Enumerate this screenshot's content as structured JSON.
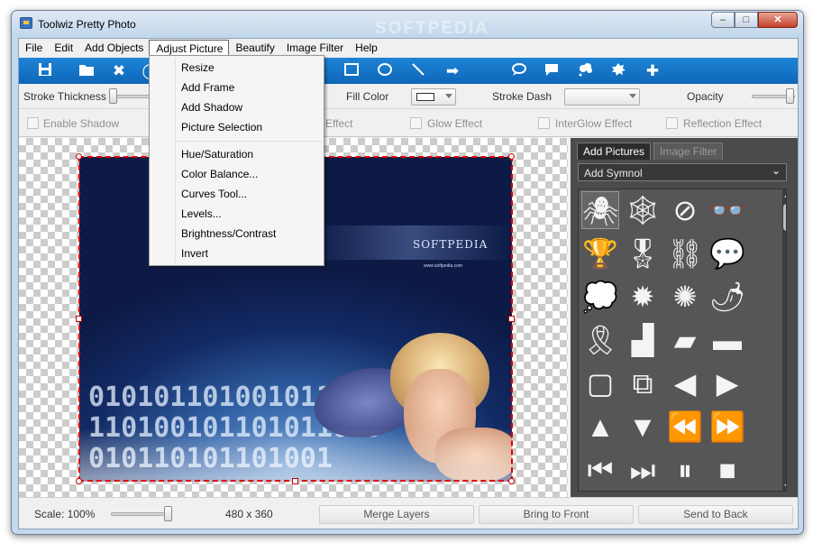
{
  "window": {
    "title": "Toolwiz Pretty Photo",
    "minimize": "–",
    "maximize": "□",
    "close": "✕"
  },
  "watermarks": [
    "SOFTPEDIA",
    "SOFTPEDIA"
  ],
  "menu": {
    "items": [
      "File",
      "Edit",
      "Add Objects",
      "Adjust Picture",
      "Beautify",
      "Image Filter",
      "Help"
    ],
    "active": "Adjust Picture"
  },
  "dropdown": {
    "items": [
      "Resize",
      "Add Frame",
      "Add Shadow",
      "Picture Selection",
      "Hue/Saturation",
      "Color Balance...",
      "Curves Tool...",
      "Levels...",
      "Brightness/Contrast",
      "Invert"
    ]
  },
  "toolbar": {
    "icons": [
      "save-icon",
      "open-folder-icon",
      "delete-icon",
      "ellipse-tool-icon",
      "rectangle-icon",
      "circle-icon",
      "line-icon",
      "arrow-icon",
      "speech-bubble-icon",
      "callout-icon",
      "cloud-bubble-icon",
      "burst-bubble-icon",
      "puzzle-icon"
    ]
  },
  "props": {
    "stroke_thickness": "Stroke Thickness",
    "fill_color": "Fill Color",
    "stroke_dash": "Stroke Dash",
    "opacity": "Opacity",
    "enable_shadow": "Enable Shadow",
    "effect": "Effect",
    "glow_effect": "Glow Effect",
    "interglow_effect": "InterGlow Effect",
    "reflection_effect": "Reflection Effect"
  },
  "photo": {
    "logo": "SOFTPEDIA",
    "url": "www.softpedia.com",
    "digits": "010101101001011010110100101101011010010110101101001"
  },
  "panel": {
    "tabs": [
      "Add Pictures",
      "Image Filter"
    ],
    "symbol_select": "Add Symnol",
    "symbols": [
      "spider-icon",
      "web-icon",
      "no-drink-icon",
      "sunglasses-icon",
      "trophy-icon",
      "medal-icon",
      "chain-icon",
      "speech-bubble-icon",
      "ellipse-bubble-icon",
      "burst-icon",
      "explosion-icon",
      "chili-icon",
      "ribbon-icon",
      "stairs-icon",
      "parallelogram-icon",
      "bar-icon",
      "frame-icon",
      "double-frame-icon",
      "triangle-left-icon",
      "triangle-right-icon",
      "triangle-up-icon",
      "triangle-down-icon",
      "double-left-icon",
      "double-right-icon",
      "skip-back-icon",
      "skip-forward-icon",
      "pause-icon",
      "square-icon"
    ]
  },
  "status": {
    "scale": "Scale: 100%",
    "dimensions": "480 x 360",
    "merge_layers": "Merge Layers",
    "bring_to_front": "Bring to Front",
    "send_to_back": "Send to Back"
  }
}
